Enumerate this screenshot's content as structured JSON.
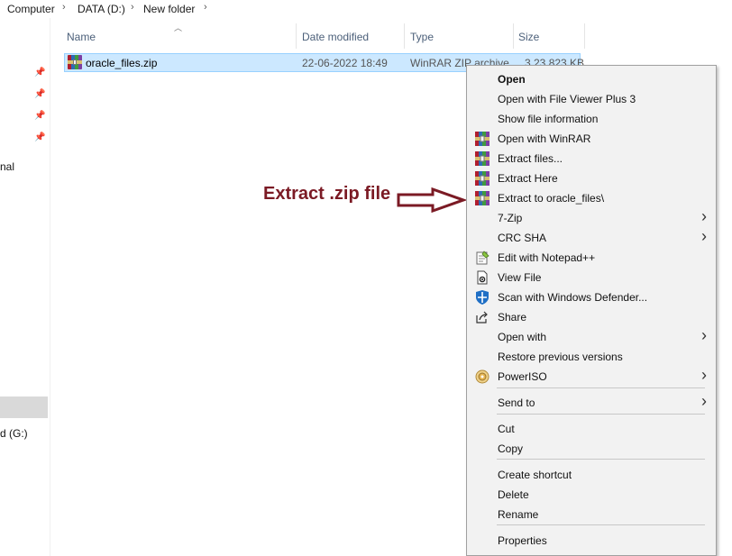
{
  "breadcrumb": {
    "items": [
      "Computer",
      "DATA (D:)",
      "New folder"
    ],
    "separator": "›"
  },
  "nav": {
    "partial_label_1": "nal",
    "partial_label_2": "d (G:)"
  },
  "columns": {
    "name": "Name",
    "date_modified": "Date modified",
    "type": "Type",
    "size": "Size"
  },
  "file": {
    "name": "oracle_files.zip",
    "date": "22-06-2022 18:49",
    "type": "WinRAR ZIP archive",
    "size": "3,23,823 KB",
    "icon": "winrar-icon"
  },
  "annotation": {
    "text": "Extract .zip file",
    "color": "#7b1a24"
  },
  "context_menu": {
    "items": [
      {
        "label": "Open",
        "bold": true
      },
      {
        "label": "Open with File Viewer Plus 3"
      },
      {
        "label": "Show file information"
      },
      {
        "label": "Open with WinRAR",
        "icon": "winrar-icon"
      },
      {
        "label": "Extract files...",
        "icon": "winrar-icon"
      },
      {
        "label": "Extract Here",
        "icon": "winrar-icon"
      },
      {
        "label": "Extract to oracle_files\\",
        "icon": "winrar-icon"
      },
      {
        "label": "7-Zip",
        "submenu": true
      },
      {
        "label": "CRC SHA",
        "submenu": true
      },
      {
        "label": "Edit with Notepad++",
        "icon": "notepad-plus-plus-icon"
      },
      {
        "label": "View File",
        "icon": "view-file-icon"
      },
      {
        "label": "Scan with Windows Defender...",
        "icon": "windows-defender-icon"
      },
      {
        "label": "Share",
        "icon": "share-icon"
      },
      {
        "label": "Open with",
        "submenu": true
      },
      {
        "label": "Restore previous versions"
      },
      {
        "label": "PowerISO",
        "icon": "poweriso-icon",
        "submenu": true
      },
      {
        "label": "Send to",
        "submenu": true
      },
      {
        "label": "Cut"
      },
      {
        "label": "Copy"
      },
      {
        "label": "Create shortcut"
      },
      {
        "label": "Delete"
      },
      {
        "label": "Rename"
      },
      {
        "label": "Properties"
      }
    ]
  }
}
